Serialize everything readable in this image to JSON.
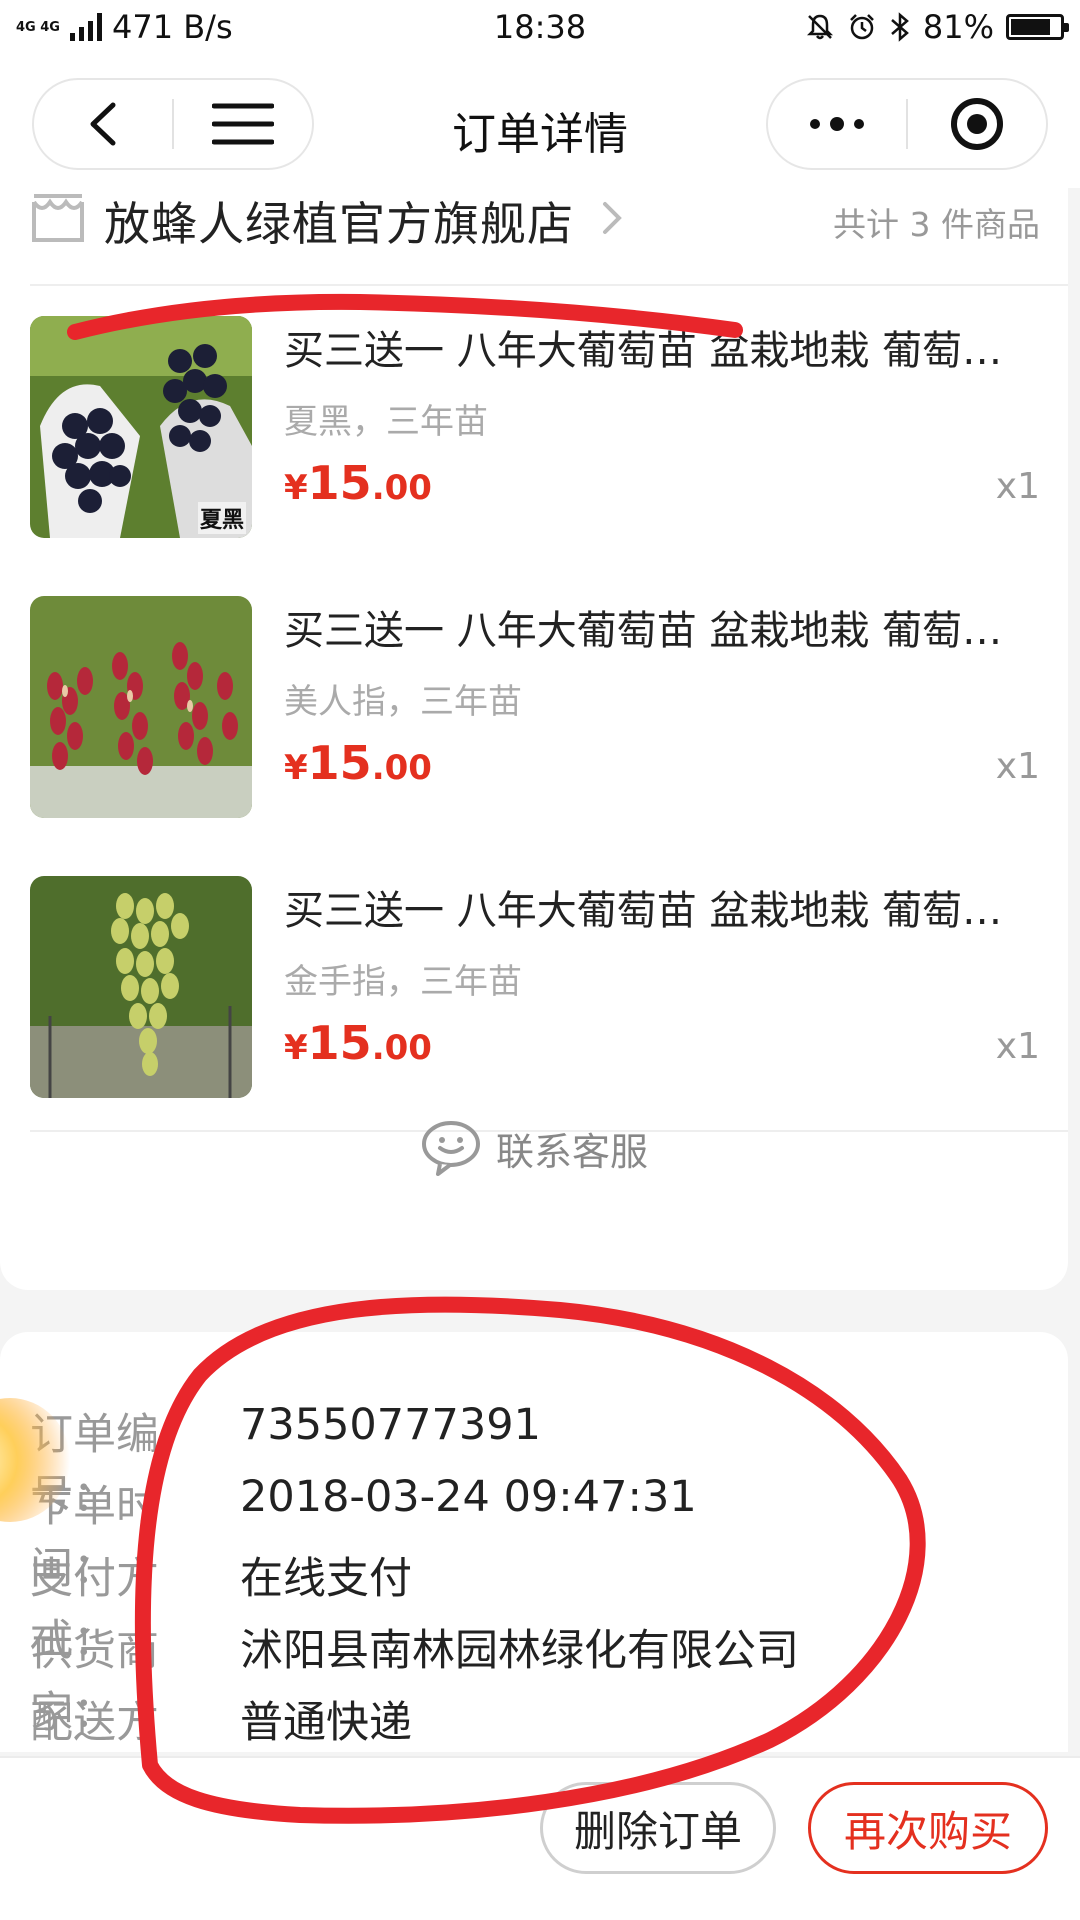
{
  "status_bar": {
    "network": "4G 4G",
    "speed": "471 B/s",
    "time": "18:38",
    "battery_text": "81%",
    "battery_level": 0.81,
    "icons": [
      "mute-bell-icon",
      "alarm-icon",
      "bluetooth-icon"
    ]
  },
  "navbar": {
    "title": "订单详情",
    "back_icon": "back-arrow-icon",
    "menu_icon": "hamburger-menu-icon",
    "more_icon": "more-dots-icon",
    "close_icon": "target-circle-icon"
  },
  "store": {
    "name": "放蜂人绿植官方旗舰店",
    "count_label": "共计 3 件商品"
  },
  "items": [
    {
      "title": "买三送一 八年大葡萄苗 盆栽地栽 葡萄…",
      "spec": "夏黑，三年苗",
      "price_symbol": "¥",
      "price_int": "15",
      "price_dec": ".00",
      "qty": "x1",
      "image_caption": "夏黑"
    },
    {
      "title": "买三送一 八年大葡萄苗 盆栽地栽 葡萄…",
      "spec": "美人指，三年苗",
      "price_symbol": "¥",
      "price_int": "15",
      "price_dec": ".00",
      "qty": "x1"
    },
    {
      "title": "买三送一 八年大葡萄苗 盆栽地栽 葡萄…",
      "spec": "金手指，三年苗",
      "price_symbol": "¥",
      "price_int": "15",
      "price_dec": ".00",
      "qty": "x1"
    }
  ],
  "service": {
    "label": "联系客服",
    "icon": "customer-service-smile-icon"
  },
  "order_info": [
    {
      "label": "订单编号：",
      "value": "73550777391"
    },
    {
      "label": "下单时间：",
      "value": "2018-03-24 09:47:31"
    },
    {
      "label": "支付方式：",
      "value": "在线支付"
    },
    {
      "label": "供货商家：",
      "value": "沭阳县南林园林绿化有限公司"
    },
    {
      "label": "配送方式：",
      "value": "普通快递"
    }
  ],
  "actions": {
    "delete_label": "删除订单",
    "rebuy_label": "再次购买"
  },
  "colors": {
    "accent": "#e4301f",
    "annotation": "#e8262b",
    "muted": "#999999"
  }
}
